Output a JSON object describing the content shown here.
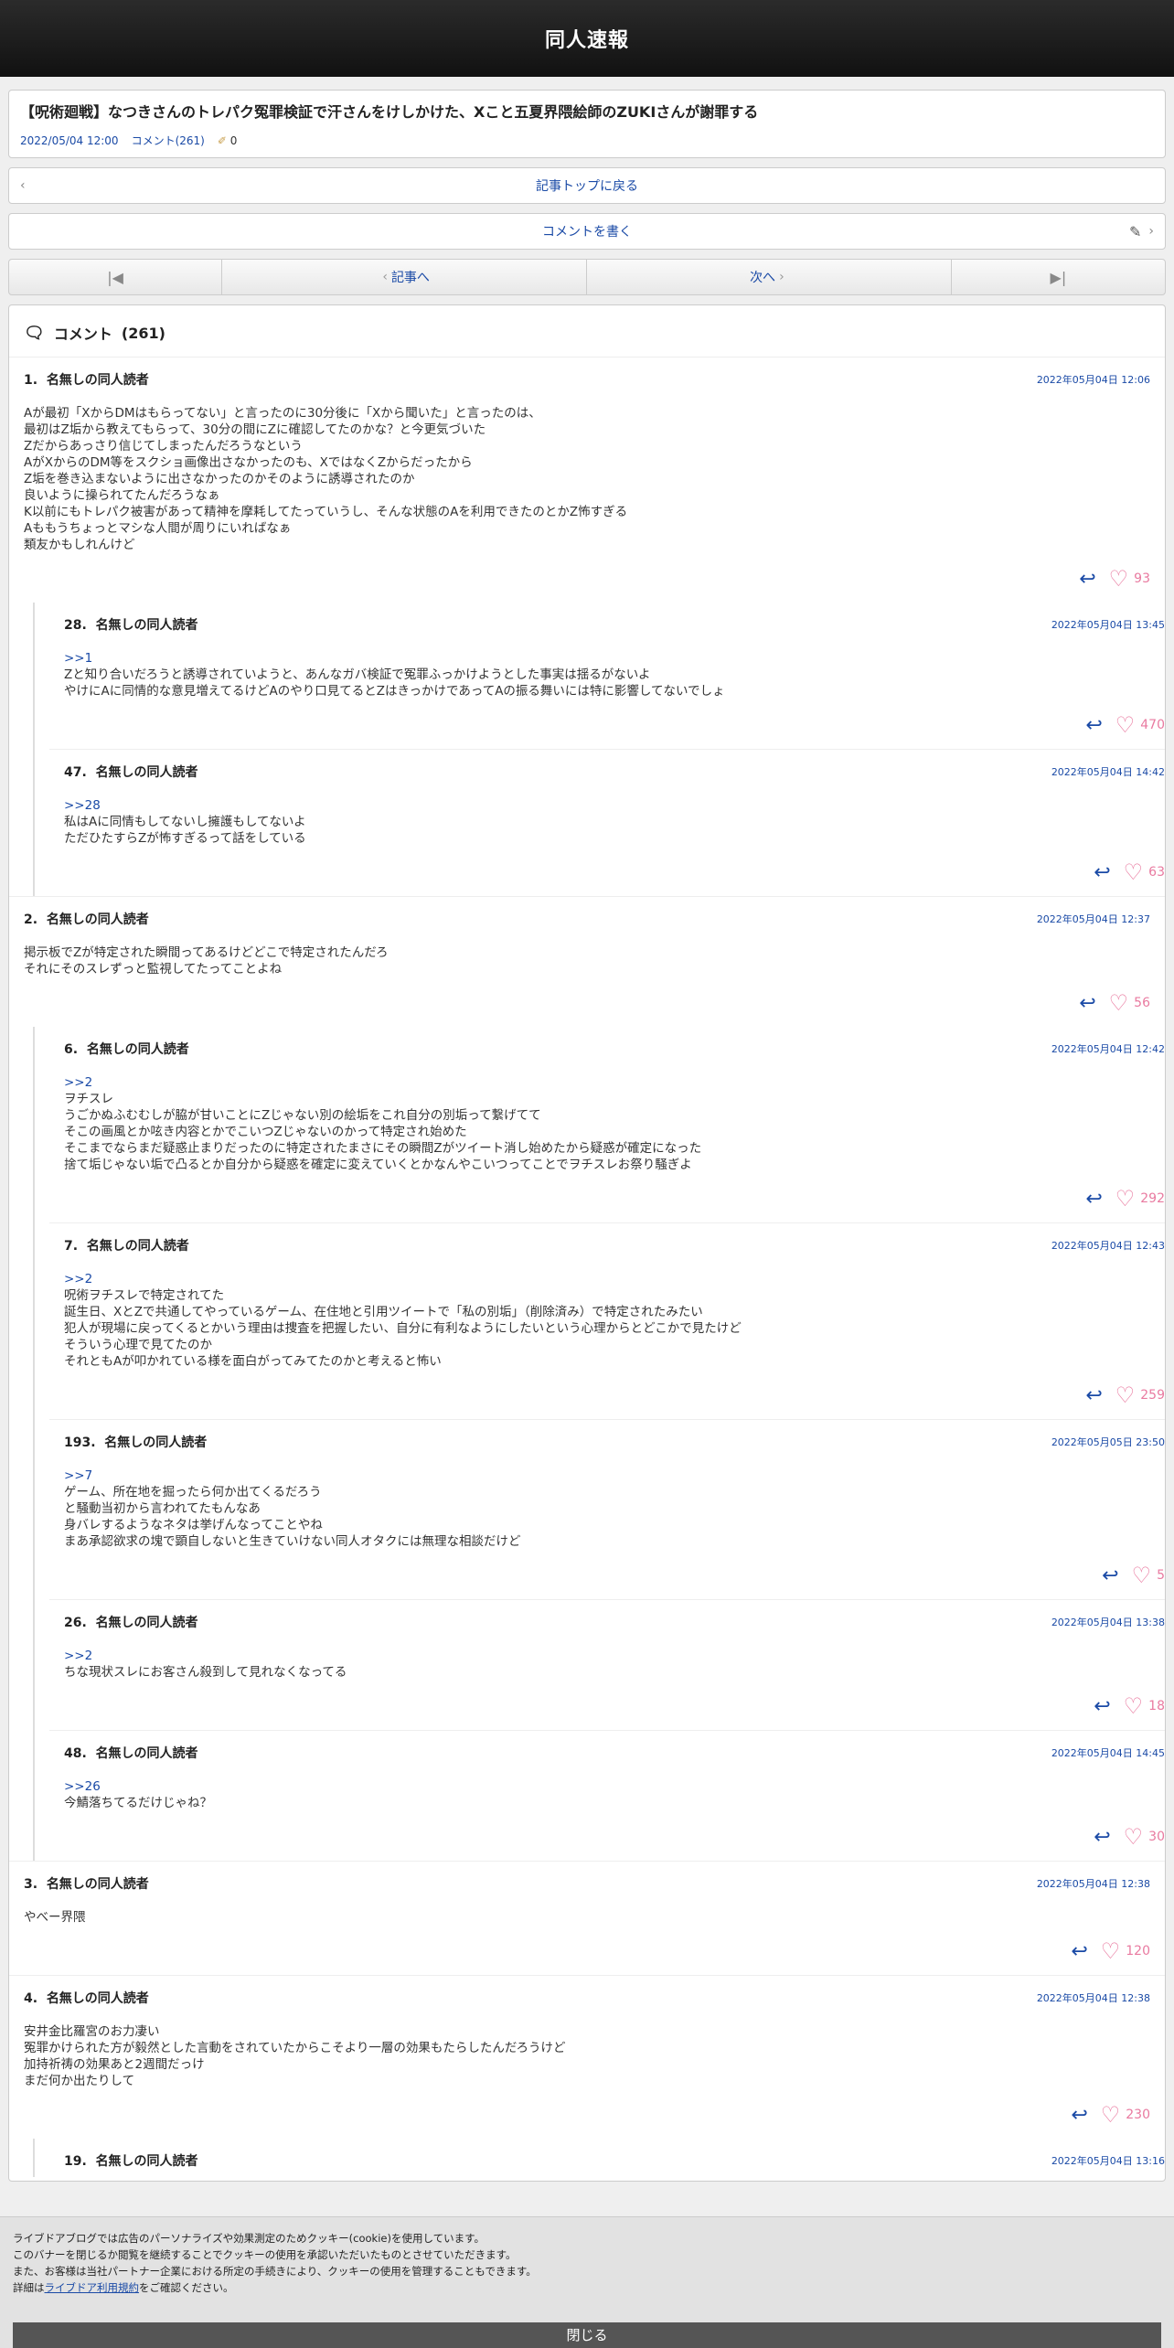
{
  "header": {
    "site_title": "同人速報"
  },
  "article": {
    "title": "【呪術廻戦】なつきさんのトレパク冤罪検証で汗さんをけしかけた、Xこと五夏界隈絵師のZUKIさんが謝罪する",
    "date": "2022/05/04 12:00",
    "comment_link": "コメント(261)",
    "count": "0"
  },
  "nav": {
    "back_to_top": "記事トップに戻る",
    "write_comment": "コメントを書く",
    "prev": "記事へ",
    "next": "次へ"
  },
  "comments_section": {
    "title": "コメント",
    "count": "(261)"
  },
  "comments": [
    {
      "num": "1.",
      "name": "名無しの同人読者",
      "date": "2022年05月04日 12:06",
      "anchor": "",
      "body": "Aが最初「XからDMはもらってない」と言ったのに30分後に「Xから聞いた」と言ったのは、\n最初はZ垢から教えてもらって、30分の間にZに確認してたのかな？と今更気づいた\nZだからあっさり信じてしまったんだろうなという\nAがXからのDM等をスクショ画像出さなかったのも、XではなくZからだったから\nZ垢を巻き込まないように出さなかったのかそのように誘導されたのか\n良いように操られてたんだろうなぁ\nK以前にもトレパク被害があって精神を摩耗してたっていうし、そんな状態のAを利用できたのとかZ怖すぎる\nAももうちょっとマシな人間が周りにいればなぁ\n類友かもしれんけど",
      "likes": "93"
    },
    {
      "num": "28.",
      "name": "名無しの同人読者",
      "date": "2022年05月04日 13:45",
      "anchor": ">>1",
      "body": "Zと知り合いだろうと誘導されていようと、あんなガバ検証で冤罪ふっかけようとした事実は揺るがないよ\nやけにAに同情的な意見増えてるけどAのやり口見てるとZはきっかけであってAの振る舞いには特に影響してないでしょ",
      "likes": "470"
    },
    {
      "num": "47.",
      "name": "名無しの同人読者",
      "date": "2022年05月04日 14:42",
      "anchor": ">>28",
      "body": "私はAに同情もしてないし擁護もしてないよ\nただひたすらZが怖すぎるって話をしている",
      "likes": "63"
    },
    {
      "num": "2.",
      "name": "名無しの同人読者",
      "date": "2022年05月04日 12:37",
      "anchor": "",
      "body": "掲示板でZが特定された瞬間ってあるけどどこで特定されたんだろ\nそれにそのスレずっと監視してたってことよね",
      "likes": "56"
    },
    {
      "num": "6.",
      "name": "名無しの同人読者",
      "date": "2022年05月04日 12:42",
      "anchor": ">>2",
      "body": "ヲチスレ\nうごかぬふむむしが脇が甘いことにZじゃない別の絵垢をこれ自分の別垢って繋げてて\nそこの画風とか呟き内容とかでこいつZじゃないのかって特定され始めた\nそこまでならまだ疑惑止まりだったのに特定されたまさにその瞬間Zがツイート消し始めたから疑惑が確定になった\n捨て垢じゃない垢で凸るとか自分から疑惑を確定に変えていくとかなんやこいつってことでヲチスレお祭り騒ぎよ",
      "likes": "292"
    },
    {
      "num": "7.",
      "name": "名無しの同人読者",
      "date": "2022年05月04日 12:43",
      "anchor": ">>2",
      "body": "呪術ヲチスレで特定されてた\n誕生日、XとZで共通してやっているゲーム、在住地と引用ツイートで「私の別垢」（削除済み）で特定されたみたい\n犯人が現場に戻ってくるとかいう理由は捜査を把握したい、自分に有利なようにしたいという心理からとどこかで見たけど\nそういう心理で見てたのか\nそれともAが叩かれている様を面白がってみてたのかと考えると怖い",
      "likes": "259"
    },
    {
      "num": "193.",
      "name": "名無しの同人読者",
      "date": "2022年05月05日 23:50",
      "anchor": ">>7",
      "body": "ゲーム、所在地を掘ったら何か出てくるだろう\nと騒動当初から言われてたもんなあ\n身バレするようなネタは挙げんなってことやね\nまあ承認欲求の塊で顕自しないと生きていけない同人オタクには無理な相談だけど",
      "likes": "5"
    },
    {
      "num": "26.",
      "name": "名無しの同人読者",
      "date": "2022年05月04日 13:38",
      "anchor": ">>2",
      "body": "ちな現状スレにお客さん殺到して見れなくなってる",
      "likes": "18"
    },
    {
      "num": "48.",
      "name": "名無しの同人読者",
      "date": "2022年05月04日 14:45",
      "anchor": ">>26",
      "body": "今鯖落ちてるだけじゃね？",
      "likes": "30"
    },
    {
      "num": "3.",
      "name": "名無しの同人読者",
      "date": "2022年05月04日 12:38",
      "anchor": "",
      "body": "やべー界隈",
      "likes": "120"
    },
    {
      "num": "4.",
      "name": "名無しの同人読者",
      "date": "2022年05月04日 12:38",
      "anchor": "",
      "body": "安井金比羅宮のお力凄い\n冤罪かけられた方が毅然とした言動をされていたからこそより一層の効果もたらしたんだろうけど\n加持祈祷の効果あと2週間だっけ\nまだ何か出たりして",
      "likes": "230"
    },
    {
      "num": "19.",
      "name": "名無しの同人読者",
      "date": "2022年05月04日 13:16",
      "anchor": "",
      "body": "",
      "likes": ""
    }
  ],
  "cookie_banner": {
    "line1": "ライブドアブログでは広告のパーソナライズや効果測定のためクッキー(cookie)を使用しています。",
    "line2": "このバナーを閉じるか閲覧を継続することでクッキーの使用を承認いただいたものとさせていただきます。",
    "line3": "また、お客様は当社パートナー企業における所定の手続きにより、クッキーの使用を管理することもできます。",
    "line4_prefix": "詳細は",
    "line4_link": "ライブドア利用規約",
    "line4_suffix": "をご確認ください。",
    "close": "閉じる"
  },
  "colors": {
    "accent": "#1a4aa6",
    "like": "#e97aa0",
    "header_bg": "#1c1c1c"
  }
}
